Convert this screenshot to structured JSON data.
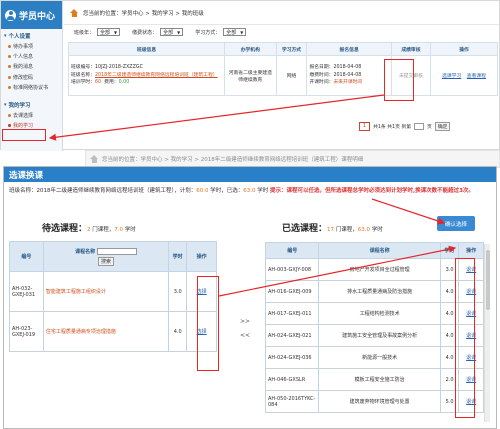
{
  "top": {
    "sidebar": {
      "title": "学员中心",
      "section1": "个人设置",
      "items1": [
        "待办事项",
        "个人信息",
        "我的消息",
        "修改密码",
        "标准网络协议书"
      ],
      "section2": "我的学习",
      "items2": [
        "去课选择",
        "我的学习"
      ]
    },
    "breadcrumb": "您当前的位置：学员中心 > 我的学习 > 我的班级",
    "filters": {
      "label1": "班级年：",
      "value1": "全部",
      "label2": "缴费状态：",
      "value2": "全部",
      "label3": "学习方式：",
      "value3": "全部"
    },
    "table": {
      "headers": [
        "班级信息",
        "办学机构",
        "学习方式",
        "报名信息",
        "成绩审核",
        "操作"
      ],
      "row": {
        "class_no_label": "班级编号：",
        "class_no": "10JZJ-2018-ZXZZGC",
        "class_name_label": "班级名称：",
        "class_name": "2018年二级建造师继续教育网络远程培训班（建筑工程）",
        "hours_label": "培训学时：",
        "hours_value": "60",
        "pay_label": "费用：",
        "pay_value": "0.00",
        "institution": "河南省二级主要建造师继续教育",
        "mode": "网络",
        "enroll_label": "报名日期：",
        "enroll_value": "2018-04-08",
        "pay_date_label": "缴费时间：",
        "pay_date_value": "2018-04-08",
        "status_label": "开课时间：",
        "status_value": "未来开课时间",
        "review": "未提交审核",
        "op1": "选课学习",
        "op2": "查看课程"
      }
    },
    "pager": {
      "first": "1",
      "info": "共1条 共1页 到第",
      "page_unit": "页",
      "go": "确定"
    }
  },
  "faded_breadcrumb": "您当前的位置：学员中心 > 我的学习 > 2018年二级建造师继续教育网络远程培训班（建筑工程）课程明细",
  "dialog": {
    "title": "选课换课",
    "info_prefix": "班级名称：2018年二级建造师继续教育网络远程培训班（建筑工程），计划：",
    "plan_hours": "60.0",
    "info_mid": " 学时，已选：",
    "chosen_hours": "63.0",
    "info_suffix": " 学时",
    "warning": "提示：课程可以任选，但所选课程总学时必须达到计划学时,换课次数不能超过3次。",
    "left": {
      "title": "待选课程：",
      "count": "2",
      "count_unit": " 门课程，",
      "hours": "7.0",
      "hours_unit": " 学时",
      "headers": {
        "no": "编号",
        "name": "课程名称",
        "search_btn": "搜索",
        "hours": "学时",
        "op": "操作"
      },
      "rows": [
        {
          "no": "AH-032-GXEJ-031",
          "name": "智能建筑工程施工组织设计",
          "hours": "3.0",
          "op": "选择"
        },
        {
          "no": "AH-023-GXEJ-019",
          "name": "住宅工程质量通病专项治理措施",
          "hours": "4.0",
          "op": "选择"
        }
      ]
    },
    "right": {
      "title": "已选课程：",
      "count": "17",
      "count_unit": " 门课程，",
      "hours": "63.0",
      "hours_unit": " 学时",
      "confirm": "确认选择",
      "headers": {
        "no": "编号",
        "name": "课程名称",
        "hours": "学时",
        "op": "操作"
      },
      "rows": [
        {
          "no": "AH-003-GXJY-008",
          "name": "房地产开发项目全过程管理",
          "hours": "3.0",
          "op": "退课"
        },
        {
          "no": "AH-016-GXEJ-009",
          "name": "排水工程质量通病及防治措施",
          "hours": "4.0",
          "op": "退课"
        },
        {
          "no": "AH-017-GXEJ-011",
          "name": "工程结构检测技术",
          "hours": "4.0",
          "op": "退课"
        },
        {
          "no": "AH-024-GXEJ-021",
          "name": "建筑施工安全管理及事故案例分析",
          "hours": "4.0",
          "op": "退课"
        },
        {
          "no": "AH-024-GXEJ-036",
          "name": "新能源一般技术",
          "hours": "4.0",
          "op": "退课"
        },
        {
          "no": "AH-046-GXSLR",
          "name": "模板工程安全施工防治",
          "hours": "2.0",
          "op": "退课"
        },
        {
          "no": "AH-050-2016TYKC-084",
          "name": "建筑废弃物环境管理与处置",
          "hours": "5.0",
          "op": "退课"
        }
      ]
    },
    "move_right": ">>",
    "move_left": "<<"
  },
  "colors": {
    "accent": "#2a7fc9",
    "highlight": "#e5262b",
    "orange": "#e07a1f"
  }
}
